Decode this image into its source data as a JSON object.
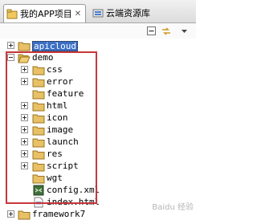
{
  "tabs": [
    {
      "label": "我的APP项目",
      "close": "✕"
    },
    {
      "label": "云端资源库"
    }
  ],
  "toolbar": {
    "buttons": [
      "collapse-all-icon",
      "link-editor-icon"
    ]
  },
  "tree": {
    "project_item": {
      "label": "apicloud"
    },
    "demo": {
      "label": "demo"
    },
    "children": [
      {
        "label": "css",
        "expanded": false
      },
      {
        "label": "error",
        "expanded": false
      },
      {
        "label": "feature",
        "expanded": null
      },
      {
        "label": "html",
        "expanded": false
      },
      {
        "label": "icon",
        "expanded": false
      },
      {
        "label": "image",
        "expanded": false
      },
      {
        "label": "launch",
        "expanded": false
      },
      {
        "label": "res",
        "expanded": false
      },
      {
        "label": "script",
        "expanded": false
      },
      {
        "label": "wgt",
        "expanded": null
      },
      {
        "label": "config.xml",
        "kind": "xml"
      },
      {
        "label": "index.html",
        "kind": "html"
      }
    ],
    "framework_item": {
      "label": "framework7"
    }
  },
  "watermark": {
    "text": "Baidu 经验"
  },
  "colors": {
    "highlight_box": "#c8373b",
    "selection": "#3b6fc4",
    "folder": "#e8c066"
  }
}
